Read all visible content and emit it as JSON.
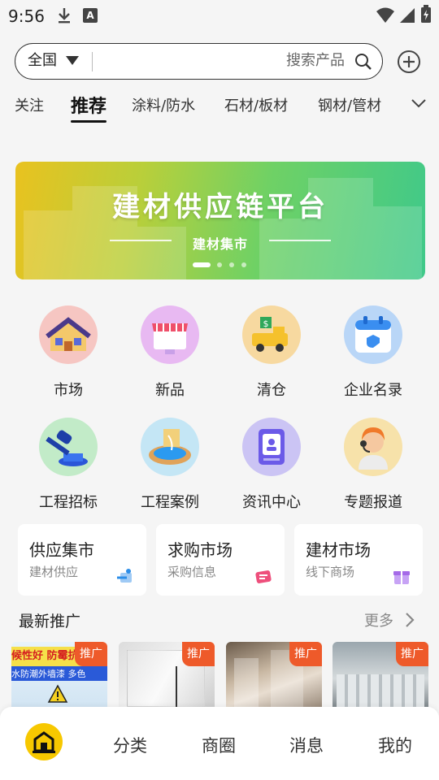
{
  "status": {
    "time": "9:56"
  },
  "search": {
    "region": "全国",
    "placeholder": "搜索产品"
  },
  "tabs": [
    {
      "label": "关注"
    },
    {
      "label": "推荐"
    },
    {
      "label": "涂料/防水"
    },
    {
      "label": "石材/板材"
    },
    {
      "label": "钢材/管材"
    }
  ],
  "banner": {
    "title": "建材供应链平台",
    "subtitle": "建材集市",
    "slides": 4,
    "active_slide": 1
  },
  "grid": [
    {
      "label": "市场",
      "icon": "house-icon",
      "color": "#f4b8b8"
    },
    {
      "label": "新品",
      "icon": "storefront-icon",
      "color": "#e6b6f0"
    },
    {
      "label": "清仓",
      "icon": "truck-icon",
      "color": "#f6d9a0"
    },
    {
      "label": "企业名录",
      "icon": "calendar-icon",
      "color": "#b8d4f5"
    },
    {
      "label": "工程招标",
      "icon": "gavel-icon",
      "color": "#bfe8c6"
    },
    {
      "label": "工程案例",
      "icon": "pool-icon",
      "color": "#bfe3f3"
    },
    {
      "label": "资讯中心",
      "icon": "news-icon",
      "color": "#c8c2f2"
    },
    {
      "label": "专题报道",
      "icon": "reporter-icon",
      "color": "#f6e0a8"
    }
  ],
  "cards": [
    {
      "title": "供应集市",
      "sub": "建材供应",
      "icon": "supply-icon",
      "color": "#2b8de8"
    },
    {
      "title": "求购市场",
      "sub": "采购信息",
      "icon": "purchase-icon",
      "color": "#ee4f7c"
    },
    {
      "title": "建材市场",
      "sub": "线下商场",
      "icon": "gift-icon",
      "color": "#a56ae8"
    }
  ],
  "section": {
    "title": "最新推广",
    "more": "更多"
  },
  "products": [
    {
      "tag": "推广",
      "text_top": "候性好 防霉抗",
      "text_mid": "水防潮外墙漆 多色"
    },
    {
      "tag": "推广"
    },
    {
      "tag": "推广"
    },
    {
      "tag": "推广"
    }
  ],
  "nav": [
    {
      "label": "首页",
      "icon": "home-icon"
    },
    {
      "label": "分类"
    },
    {
      "label": "商圈"
    },
    {
      "label": "消息"
    },
    {
      "label": "我的"
    }
  ],
  "colors": {
    "accent": "#f7c800",
    "promo": "#ee5a2a"
  }
}
